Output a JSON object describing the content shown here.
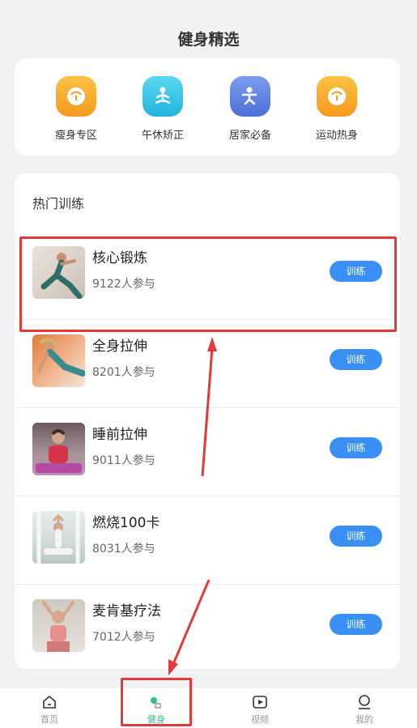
{
  "header": {
    "title": "健身精选"
  },
  "quick_entries": [
    {
      "label": "瘦身专区",
      "icon": "scale-icon",
      "color": "#f7a52b"
    },
    {
      "label": "午休矫正",
      "icon": "meditation-icon",
      "color": "#33c6e6"
    },
    {
      "label": "居家必备",
      "icon": "exercise-icon",
      "color": "#5a7fe0"
    },
    {
      "label": "运动热身",
      "icon": "scale-icon",
      "color": "#f7a52b"
    }
  ],
  "hot": {
    "title": "热门训练",
    "button_label": "训练",
    "items": [
      {
        "title": "核心锻炼",
        "participants": "9122人参与"
      },
      {
        "title": "全身拉伸",
        "participants": "8201人参与"
      },
      {
        "title": "睡前拉伸",
        "participants": "9011人参与"
      },
      {
        "title": "燃烧100卡",
        "participants": "8031人参与"
      },
      {
        "title": "麦肯基疗法",
        "participants": "7012人参与"
      }
    ]
  },
  "bottom_nav": [
    {
      "label": "首页",
      "icon": "home-icon"
    },
    {
      "label": "健身",
      "icon": "fitness-icon",
      "active": true
    },
    {
      "label": "视频",
      "icon": "video-icon"
    },
    {
      "label": "我的",
      "icon": "profile-icon"
    }
  ],
  "colors": {
    "accent": "#3a8ff5",
    "active_tab": "#2ec08e",
    "annotation": "#e23a3a"
  }
}
